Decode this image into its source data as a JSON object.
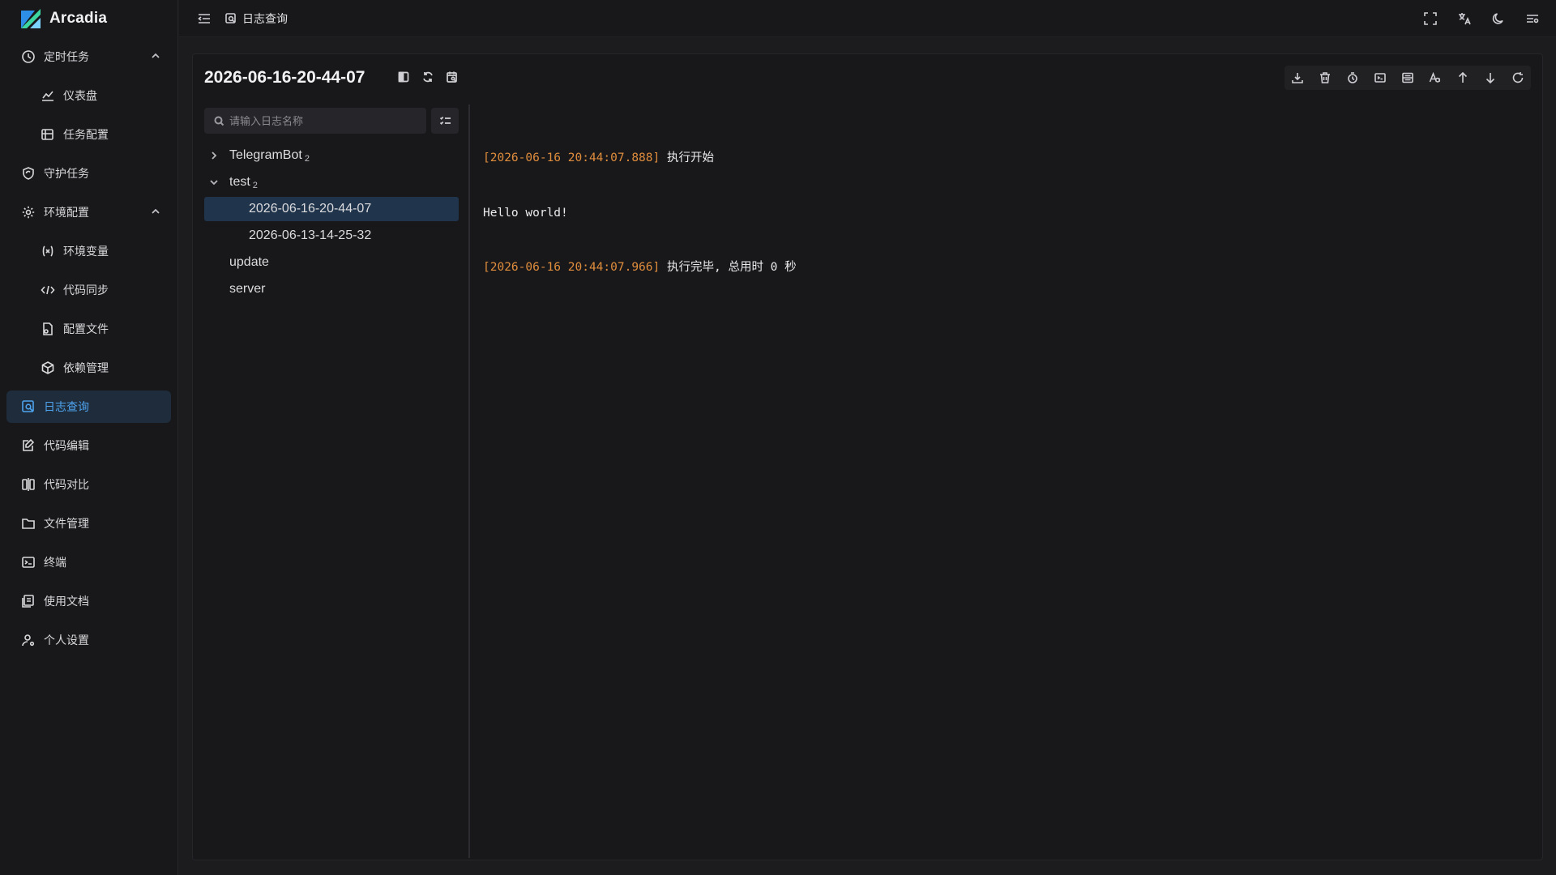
{
  "app": {
    "name": "Arcadia",
    "brand_color": "#4ea3ef"
  },
  "sidebar": {
    "items": [
      {
        "label": "定时任务",
        "icon": "clock-icon",
        "expandable": true
      },
      {
        "label": "仪表盘",
        "icon": "chart-line-icon",
        "sub": true
      },
      {
        "label": "任务配置",
        "icon": "task-config-icon",
        "sub": true
      },
      {
        "label": "守护任务",
        "icon": "shield-refresh-icon"
      },
      {
        "label": "环境配置",
        "icon": "gear-icon",
        "expandable": true
      },
      {
        "label": "环境变量",
        "icon": "variable-icon",
        "sub": true
      },
      {
        "label": "代码同步",
        "icon": "code-sync-icon",
        "sub": true
      },
      {
        "label": "配置文件",
        "icon": "file-config-icon",
        "sub": true
      },
      {
        "label": "依赖管理",
        "icon": "package-icon",
        "sub": true
      },
      {
        "label": "日志查询",
        "icon": "log-search-icon",
        "active": true
      },
      {
        "label": "代码编辑",
        "icon": "edit-icon"
      },
      {
        "label": "代码对比",
        "icon": "diff-icon"
      },
      {
        "label": "文件管理",
        "icon": "folder-icon"
      },
      {
        "label": "终端",
        "icon": "terminal-icon"
      },
      {
        "label": "使用文档",
        "icon": "docs-icon"
      },
      {
        "label": "个人设置",
        "icon": "user-settings-icon"
      }
    ]
  },
  "header": {
    "breadcrumb": "日志查询",
    "right_icons": [
      "fullscreen-icon",
      "translate-icon",
      "moon-icon",
      "settings-sliders-icon"
    ]
  },
  "log_panel": {
    "title": "2026-06-16-20-44-07",
    "search_placeholder": "请输入日志名称",
    "toolbar_icons": [
      "download-icon",
      "trash-icon",
      "clock-history-icon",
      "terminal-box-icon",
      "wrap-lines-icon",
      "font-size-icon",
      "arrow-up-icon",
      "arrow-down-icon",
      "refresh-icon"
    ],
    "tree": [
      {
        "name": "TelegramBot",
        "count": "2",
        "expanded": false
      },
      {
        "name": "test",
        "count": "2",
        "expanded": true,
        "children": [
          {
            "name": "2026-06-16-20-44-07",
            "selected": true
          },
          {
            "name": "2026-06-13-14-25-32"
          }
        ]
      },
      {
        "name": "update"
      },
      {
        "name": "server"
      }
    ],
    "log_lines": [
      {
        "ts": "[2026-06-16 20:44:07.888]",
        "text": " 执行开始"
      },
      {
        "ts": "",
        "text": "Hello world!"
      },
      {
        "ts": "[2026-06-16 20:44:07.966]",
        "text": " 执行完毕, 总用时 0 秒"
      }
    ],
    "timestamp_color": "#e08d3c"
  }
}
